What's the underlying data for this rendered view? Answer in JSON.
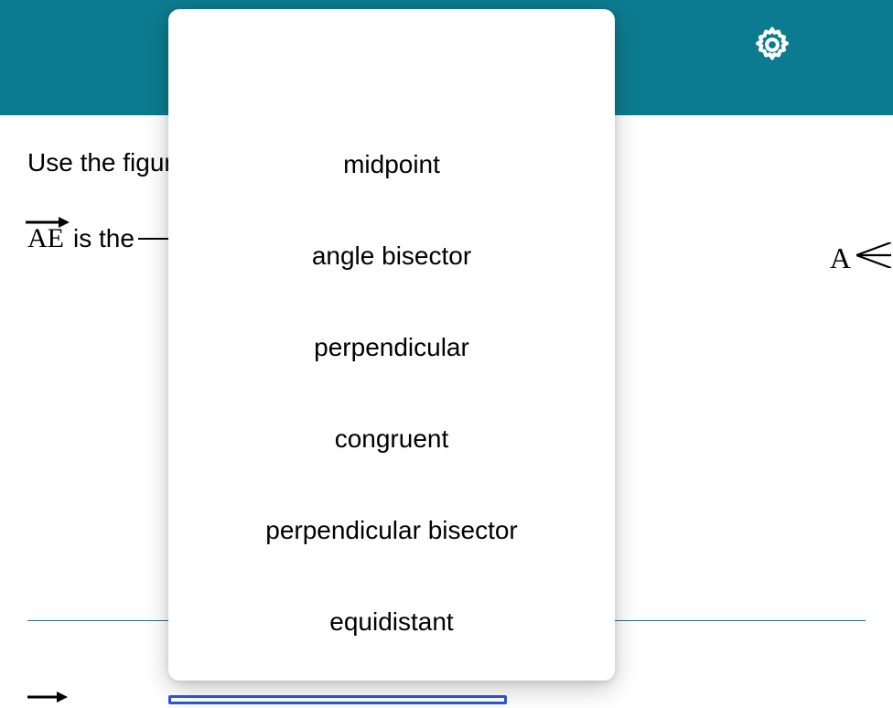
{
  "header": {
    "gear_icon": "gear"
  },
  "content": {
    "instruction": "Use the figure to complete the statement.",
    "statement_prefix_ray": "AE",
    "statement_middle": " is the ",
    "point_label": "A"
  },
  "dropdown": {
    "options": [
      "midpoint",
      "angle bisector",
      "perpendicular",
      "congruent",
      "perpendicular bisector",
      "equidistant"
    ]
  }
}
